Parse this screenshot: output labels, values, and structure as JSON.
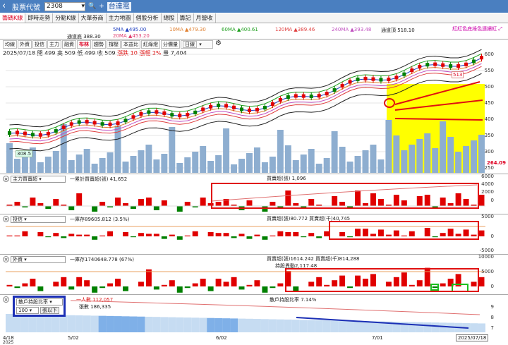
{
  "header": {
    "back_icon": "chevron-left-icon",
    "title": "股票代號",
    "code": "2308",
    "name": "台達電"
  },
  "tabs": [
    {
      "label": "籌碼K線",
      "active": true
    },
    {
      "label": "即時走勢"
    },
    {
      "label": "分點K線"
    },
    {
      "label": "大單券商"
    },
    {
      "label": "主力地圖"
    },
    {
      "label": "個股分析"
    },
    {
      "label": "總股"
    },
    {
      "label": "籌記"
    },
    {
      "label": "月營收"
    }
  ],
  "ma_legend": {
    "ma5": "5MA ▲495.00",
    "ma10": "10MA ▲479.30",
    "ma60": "60MA ▲400.61",
    "ma120": "120MA ▲389.46",
    "ma240": "240MA ▲393.48",
    "channel_top": "通道頂 518.10",
    "channel_bottom": "通道底 388.30",
    "ma20": "20MA ▲453.20"
  },
  "right_button": "紅紅色底綠色連續紅",
  "subtabs": [
    "均線",
    "外資",
    "投信",
    "主力",
    "融資",
    "布林",
    "趨勢",
    "撐壓",
    "本益比",
    "紅綠燈",
    "分價量"
  ],
  "period": "日線",
  "quote": {
    "date": "2025/07/18",
    "open": "開 499",
    "high": "高 509",
    "low": "低 499",
    "close": "收 509",
    "change": "漲跌 10",
    "pct": "漲幅 2%",
    "volume": "量 7,404"
  },
  "price_axis": [
    "600",
    "550",
    "500",
    "450",
    "400",
    "350",
    "300",
    "250"
  ],
  "price_labels": {
    "high_marker": "513",
    "low_marker": "308.5",
    "last": "264.09"
  },
  "panels": {
    "main_force": {
      "select": "主力買賣超",
      "cum": "一累計買賣超(張) 41,652",
      "daily": "買賣超(張) 1,096",
      "axis": [
        "6000",
        "4000",
        "2000",
        "0"
      ]
    },
    "trust": {
      "select": "投信",
      "hold": "一庫存89605.812 (3.5%)",
      "daily": "買賣超(張)80.772 買賣超(千)40,745",
      "axis": [
        "5000",
        "0",
        "-5000"
      ]
    },
    "foreign": {
      "select": "外資",
      "hold": "一庫存1740648.778 (67%)",
      "daily": "買賣超(張)1614.242 買賣超(千)814,288",
      "holders": "持股異動2,117.48",
      "axis": [
        "10000",
        "5000",
        "0"
      ]
    },
    "holders": {
      "select": "散戶持股比率",
      "filter_value": "100",
      "filter_label": "張以下",
      "people": "一人數 112,057",
      "shares": "張數 186,335",
      "ratio": "散戶持股比率 7.14%",
      "axis": [
        "9",
        "8",
        "7"
      ]
    }
  },
  "dates": [
    "4/18",
    "5/02",
    "6/02",
    "7/01",
    "2025/07/18"
  ],
  "year_label": "2025",
  "colors": {
    "up": "#e00000",
    "down": "#008000",
    "highlight": "#ffff00",
    "annot_red": "#e01010",
    "annot_blue": "#1b2fb5",
    "volume": "#8eaed0"
  }
}
